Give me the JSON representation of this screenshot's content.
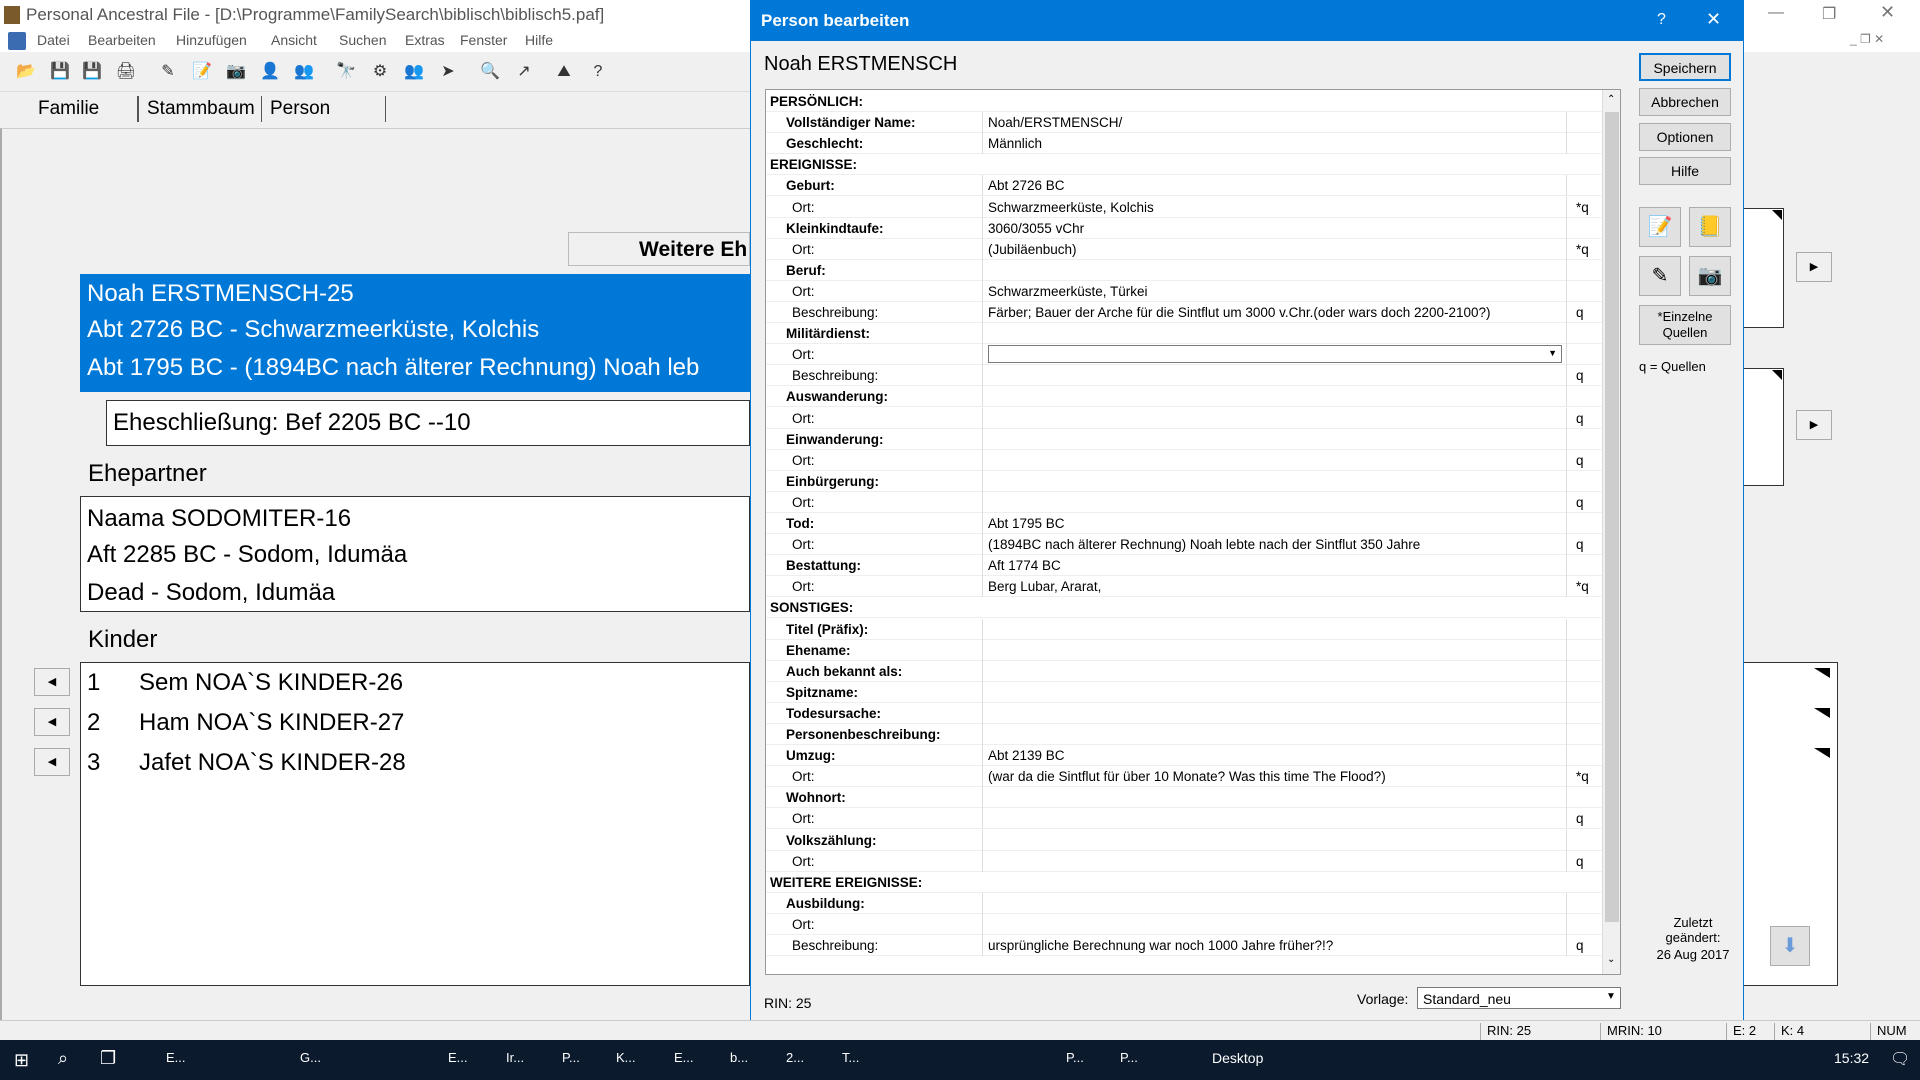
{
  "main": {
    "title": "Personal Ancestral File - [D:\\Programme\\FamilySearch\\biblisch\\biblisch5.paf]",
    "menu": [
      "Datei",
      "Bearbeiten",
      "Hinzufügen",
      "Ansicht",
      "Suchen",
      "Extras",
      "Fenster",
      "Hilfe"
    ],
    "tabs": [
      "Familie",
      "Stammbaum",
      "Person"
    ],
    "more_button": "Weitere Eh",
    "person": {
      "line1": "Noah ERSTMENSCH-25",
      "line2": "Abt 2726 BC - Schwarzmeerküste, Kolchis",
      "line3": "Abt 1795 BC - (1894BC nach älterer Rechnung) Noah leb"
    },
    "marriage": "Eheschließung: Bef 2205 BC --10",
    "spouse_heading": "Ehepartner",
    "spouse": {
      "line1": "Naama SODOMITER-16",
      "line2": "Aft 2285 BC - Sodom, Idumäa",
      "line3": "Dead - Sodom, Idumäa"
    },
    "children_heading": "Kinder",
    "children": [
      {
        "num": "1",
        "name": "Sem NOA`S KINDER-26"
      },
      {
        "num": "2",
        "name": "Ham NOA`S KINDER-27"
      },
      {
        "num": "3",
        "name": "Jafet NOA`S KINDER-28"
      }
    ]
  },
  "dialog": {
    "title": "Person bearbeiten",
    "help_glyph": "?",
    "close_glyph": "✕",
    "person_name": "Noah ERSTMENSCH",
    "buttons": {
      "save": "Speichern",
      "cancel": "Abbrechen",
      "options": "Optionen",
      "help": "Hilfe",
      "sources": "*Einzelne Quellen"
    },
    "sources_note": "q = Quellen",
    "last_changed_label": "Zuletzt geändert:",
    "last_changed_date": "26 Aug 2017",
    "rin": "RIN: 25",
    "template_label": "Vorlage:",
    "template_value": "Standard_neu",
    "rows": [
      {
        "type": "sec",
        "label": "PERSÖNLICH:",
        "value": "",
        "q": ""
      },
      {
        "type": "fld",
        "label": "Vollständiger Name:",
        "value": "Noah/ERSTMENSCH/",
        "q": ""
      },
      {
        "type": "fld",
        "label": "Geschlecht:",
        "value": "Männlich",
        "q": ""
      },
      {
        "type": "sec",
        "label": "EREIGNISSE:",
        "value": "",
        "q": ""
      },
      {
        "type": "fld",
        "label": "Geburt:",
        "value": "Abt 2726 BC",
        "q": ""
      },
      {
        "type": "sub",
        "label": "Ort:",
        "value": "Schwarzmeerküste, Kolchis",
        "q": "*q"
      },
      {
        "type": "fld",
        "label": "Kleinkindtaufe:",
        "value": "3060/3055 vChr",
        "q": ""
      },
      {
        "type": "sub",
        "label": "Ort:",
        "value": "(Jubiläenbuch)",
        "q": "*q"
      },
      {
        "type": "fld",
        "label": "Beruf:",
        "value": "",
        "q": ""
      },
      {
        "type": "sub",
        "label": "Ort:",
        "value": "Schwarzmeerküste, Türkei",
        "q": ""
      },
      {
        "type": "sub",
        "label": "Beschreibung:",
        "value": "Färber; Bauer der Arche für die Sintflut um 3000 v.Chr.(oder wars doch 2200-2100?)",
        "q": "q"
      },
      {
        "type": "fld",
        "label": "Militärdienst:",
        "value": "",
        "q": ""
      },
      {
        "type": "sub",
        "label": "Ort:",
        "value": "",
        "q": "",
        "combo": true
      },
      {
        "type": "sub",
        "label": "Beschreibung:",
        "value": "",
        "q": "q"
      },
      {
        "type": "fld",
        "label": "Auswanderung:",
        "value": "",
        "q": ""
      },
      {
        "type": "sub",
        "label": "Ort:",
        "value": "",
        "q": "q"
      },
      {
        "type": "fld",
        "label": "Einwanderung:",
        "value": "",
        "q": ""
      },
      {
        "type": "sub",
        "label": "Ort:",
        "value": "",
        "q": "q"
      },
      {
        "type": "fld",
        "label": "Einbürgerung:",
        "value": "",
        "q": ""
      },
      {
        "type": "sub",
        "label": "Ort:",
        "value": "",
        "q": "q"
      },
      {
        "type": "fld",
        "label": "Tod:",
        "value": "Abt 1795 BC",
        "q": ""
      },
      {
        "type": "sub",
        "label": "Ort:",
        "value": "(1894BC nach älterer Rechnung) Noah lebte nach der Sintflut 350 Jahre",
        "q": "q"
      },
      {
        "type": "fld",
        "label": "Bestattung:",
        "value": "Aft 1774 BC",
        "q": ""
      },
      {
        "type": "sub",
        "label": "Ort:",
        "value": "Berg Lubar, Ararat,",
        "q": "*q"
      },
      {
        "type": "sec",
        "label": "SONSTIGES:",
        "value": "",
        "q": ""
      },
      {
        "type": "fld",
        "label": "Titel (Präfix):",
        "value": "",
        "q": ""
      },
      {
        "type": "fld",
        "label": "Ehename:",
        "value": "",
        "q": ""
      },
      {
        "type": "fld",
        "label": "Auch bekannt als:",
        "value": "",
        "q": ""
      },
      {
        "type": "fld",
        "label": "Spitzname:",
        "value": "",
        "q": ""
      },
      {
        "type": "fld",
        "label": "Todesursache:",
        "value": "",
        "q": ""
      },
      {
        "type": "fld",
        "label": "Personenbeschreibung:",
        "value": "",
        "q": ""
      },
      {
        "type": "fld",
        "label": "Umzug:",
        "value": "Abt 2139 BC",
        "q": ""
      },
      {
        "type": "sub",
        "label": "Ort:",
        "value": "(war da die Sintflut für über 10 Monate? Was this time The Flood?)",
        "q": "*q"
      },
      {
        "type": "fld",
        "label": "Wohnort:",
        "value": "",
        "q": ""
      },
      {
        "type": "sub",
        "label": "Ort:",
        "value": "",
        "q": "q"
      },
      {
        "type": "fld",
        "label": "Volkszählung:",
        "value": "",
        "q": ""
      },
      {
        "type": "sub",
        "label": "Ort:",
        "value": "",
        "q": "q"
      },
      {
        "type": "sec",
        "label": "WEITERE EREIGNISSE:",
        "value": "",
        "q": ""
      },
      {
        "type": "fld",
        "label": "Ausbildung:",
        "value": "",
        "q": ""
      },
      {
        "type": "sub",
        "label": "Ort:",
        "value": "",
        "q": ""
      },
      {
        "type": "sub",
        "label": "Beschreibung:",
        "value": "ursprüngliche Berechnung war noch 1000 Jahre früher?!?",
        "q": "q"
      }
    ]
  },
  "statusbar": {
    "rin": "RIN: 25",
    "mrin": "MRIN: 10",
    "e": "E: 2",
    "k": "K: 4",
    "num": "NUM"
  },
  "taskbar": {
    "items": [
      "E...",
      "G...",
      "E...",
      "Ir...",
      "P...",
      "K...",
      "E...",
      "b...",
      "2...",
      "T...",
      "P...",
      "P..."
    ],
    "desktop": "Desktop",
    "time": "15:32"
  },
  "window_controls": {
    "minimize": "—",
    "maximize": "❐",
    "close": "✕"
  }
}
